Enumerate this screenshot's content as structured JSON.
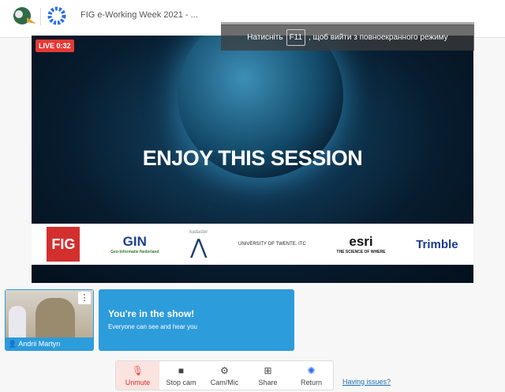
{
  "header": {
    "title": "FIG e-Working Week 2021 - ..."
  },
  "video": {
    "live_badge": "LIVE 0:32",
    "headline": "ENJOY THIS SESSION",
    "sponsors": {
      "fig": "FIG",
      "gin": "GIN",
      "gin_sub": "Geo-Informatie Nederland",
      "kadaster": "kadaster",
      "twente": "UNIVERSITY OF TWENTE.",
      "itc": "ITC",
      "esri": "esri",
      "esri_sub": "THE SCIENCE OF WHERE",
      "trimble": "Trimble"
    }
  },
  "fullscreen_notice": {
    "before": "Натисніть",
    "key": "F11",
    "after": ", щоб вийти з повноекранного режиму"
  },
  "self_view": {
    "name": "Andrii Martyn",
    "menu": "⋮"
  },
  "status": {
    "title": "You're in the show!",
    "subtitle": "Everyone can see and hear you"
  },
  "toolbar": [
    {
      "label": "Unmute",
      "icon": "🎙"
    },
    {
      "label": "Stop cam",
      "icon": "■"
    },
    {
      "label": "Cam/Mic",
      "icon": "⚙"
    },
    {
      "label": "Share",
      "icon": "⊞"
    },
    {
      "label": "Return",
      "icon": "✺"
    }
  ],
  "issues_link": "Having issues?",
  "colors": {
    "accent": "#2d9cdb",
    "live": "#e53935"
  }
}
